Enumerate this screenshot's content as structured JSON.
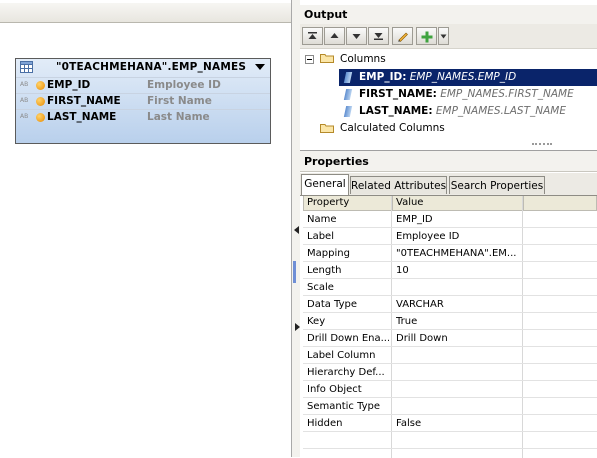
{
  "colors": {
    "selection": "#0a246a",
    "panel_header": "#f3f2ee",
    "node_gradient_top": "#e2ecf8",
    "node_gradient_bottom": "#b9d0ec",
    "mapping_text": "#6e6e6e"
  },
  "table_node": {
    "title": "\"0TEACHMEHANA\".EMP_NAMES",
    "icon": "table-icon",
    "columns": [
      {
        "type_icon": "AB",
        "name": "EMP_ID",
        "label": "Employee ID"
      },
      {
        "type_icon": "AB",
        "name": "FIRST_NAME",
        "label": "First Name"
      },
      {
        "type_icon": "AB",
        "name": "LAST_NAME",
        "label": "Last Name"
      }
    ]
  },
  "output": {
    "title": "Output",
    "toolbar": [
      "move-top-icon",
      "move-up-icon",
      "move-down-icon",
      "move-bottom-icon",
      "edit-icon",
      "add-icon",
      "dropdown-icon"
    ],
    "tree": {
      "columns_folder": "Columns",
      "items": [
        {
          "name": "EMP_ID:",
          "mapping": "EMP_NAMES.EMP_ID",
          "selected": true
        },
        {
          "name": "FIRST_NAME:",
          "mapping": "EMP_NAMES.FIRST_NAME",
          "selected": false
        },
        {
          "name": "LAST_NAME:",
          "mapping": "EMP_NAMES.LAST_NAME",
          "selected": false
        }
      ],
      "calculated_folder": "Calculated Columns"
    }
  },
  "properties": {
    "title": "Properties",
    "tabs": [
      "General",
      "Related Attributes",
      "Search Properties"
    ],
    "active_tab": "General",
    "headers": [
      "Property",
      "Value"
    ],
    "rows": [
      {
        "property": "Name",
        "value": "EMP_ID"
      },
      {
        "property": "Label",
        "value": "Employee ID"
      },
      {
        "property": "Mapping",
        "value": "\"0TEACHMEHANA\".EM..."
      },
      {
        "property": "Length",
        "value": "10"
      },
      {
        "property": "Scale",
        "value": ""
      },
      {
        "property": "Data Type",
        "value": "VARCHAR"
      },
      {
        "property": "Key",
        "value": "True"
      },
      {
        "property": "Drill Down Ena...",
        "value": "Drill Down"
      },
      {
        "property": "Label Column",
        "value": ""
      },
      {
        "property": "Hierarchy Def...",
        "value": ""
      },
      {
        "property": "Info Object",
        "value": ""
      },
      {
        "property": "Semantic Type",
        "value": ""
      },
      {
        "property": "Hidden",
        "value": "False"
      }
    ]
  }
}
